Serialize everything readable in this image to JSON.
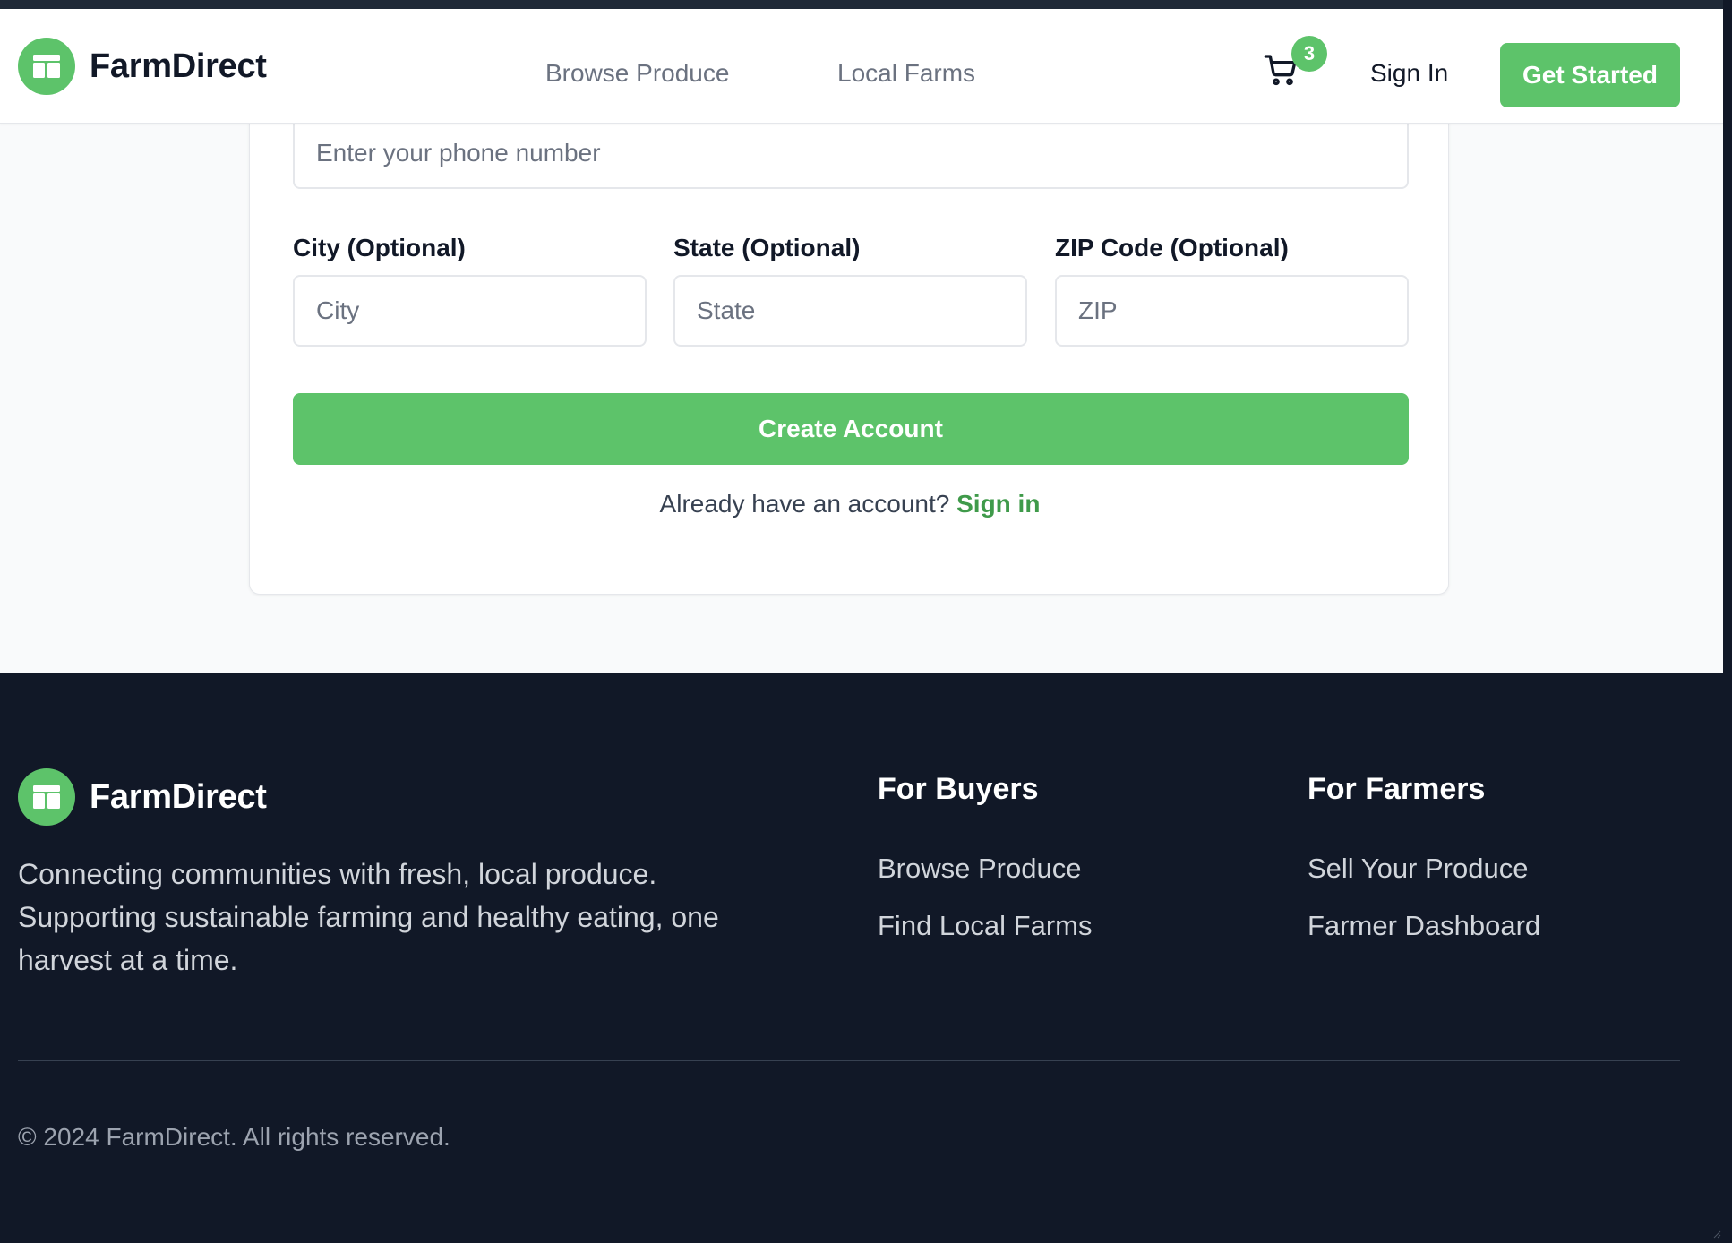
{
  "brand": {
    "name": "FarmDirect",
    "logo_icon": "storefront-icon",
    "accent": "#5dc36a"
  },
  "header": {
    "nav": [
      "Browse Produce",
      "Local Farms"
    ],
    "cart_count": "3",
    "cart_icon": "shopping-cart-icon",
    "sign_in": "Sign In",
    "get_started": "Get Started"
  },
  "form": {
    "phone": {
      "placeholder": "Enter your phone number",
      "value": ""
    },
    "city": {
      "label": "City (Optional)",
      "placeholder": "City",
      "value": ""
    },
    "state": {
      "label": "State (Optional)",
      "placeholder": "State",
      "value": ""
    },
    "zip": {
      "label": "ZIP Code (Optional)",
      "placeholder": "ZIP",
      "value": ""
    },
    "submit": "Create Account",
    "already_text": "Already have an account?",
    "sign_in_link": "Sign in"
  },
  "footer": {
    "brand": "FarmDirect",
    "description": "Connecting communities with fresh, local produce. Supporting sustainable farming and healthy eating, one harvest at a time.",
    "buyers": {
      "heading": "For Buyers",
      "links": [
        "Browse Produce",
        "Find Local Farms"
      ]
    },
    "farmers": {
      "heading": "For Farmers",
      "links": [
        "Sell Your Produce",
        "Farmer Dashboard"
      ]
    },
    "copyright": "© 2024 FarmDirect. All rights reserved."
  }
}
